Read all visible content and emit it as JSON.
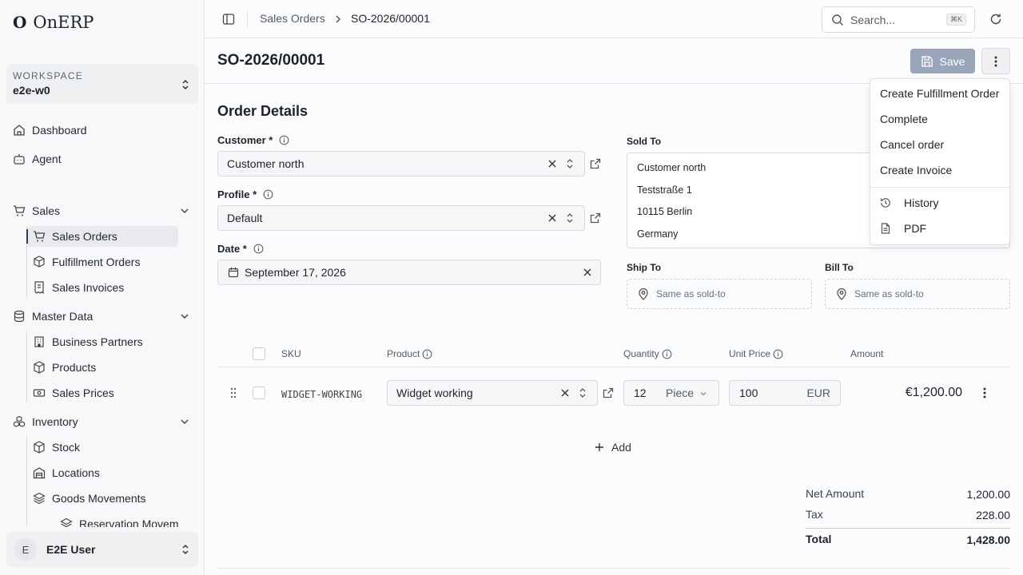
{
  "app": {
    "logo_mark": "O",
    "name": "OnERP"
  },
  "workspace": {
    "label": "WORKSPACE",
    "value": "e2e-w0"
  },
  "nav": {
    "dashboard": "Dashboard",
    "agent": "Agent",
    "sales": {
      "label": "Sales",
      "items": [
        "Sales Orders",
        "Fulfillment Orders",
        "Sales Invoices"
      ]
    },
    "master_data": {
      "label": "Master Data",
      "items": [
        "Business Partners",
        "Products",
        "Sales Prices"
      ]
    },
    "inventory": {
      "label": "Inventory",
      "items": [
        "Stock",
        "Locations",
        "Goods Movements",
        "Reservation Moveme"
      ]
    }
  },
  "user": {
    "initial": "E",
    "name": "E2E User"
  },
  "topbar": {
    "breadcrumb": [
      "Sales Orders",
      "SO-2026/00001"
    ],
    "search_placeholder": "Search...",
    "search_shortcut": "⌘K"
  },
  "page": {
    "title": "SO-2026/00001",
    "save_label": "Save"
  },
  "order_details": {
    "title": "Order Details",
    "customer": {
      "label": "Customer *",
      "value": "Customer north"
    },
    "profile": {
      "label": "Profile *",
      "value": "Default"
    },
    "date": {
      "label": "Date *",
      "value": "September 17, 2026"
    },
    "sold_to": {
      "label": "Sold To",
      "lines": [
        "Customer north",
        "Teststraße 1",
        "10115 Berlin",
        "Germany"
      ]
    },
    "ship_to": {
      "label": "Ship To",
      "placeholder": "Same as sold-to"
    },
    "bill_to": {
      "label": "Bill To",
      "placeholder": "Same as sold-to"
    }
  },
  "lines_table": {
    "headers": {
      "sku": "SKU",
      "product": "Product",
      "quantity": "Quantity",
      "unit_price": "Unit Price",
      "amount": "Amount"
    },
    "rows": [
      {
        "sku": "WIDGET-WORKING",
        "product": "Widget working",
        "quantity": "12",
        "unit": "Piece",
        "unit_price": "100",
        "currency": "EUR",
        "amount": "€1,200.00"
      }
    ],
    "add_label": "Add"
  },
  "totals": {
    "net_label": "Net Amount",
    "net_value": "1,200.00",
    "tax_label": "Tax",
    "tax_value": "228.00",
    "total_label": "Total",
    "total_value": "1,428.00"
  },
  "actions_menu": {
    "items": [
      "Create Fulfillment Order",
      "Complete",
      "Cancel order",
      "Create Invoice"
    ],
    "history": "History",
    "pdf": "PDF"
  },
  "colors": {
    "save_button": "#99a5b8",
    "accent": "#2b3a4e"
  }
}
